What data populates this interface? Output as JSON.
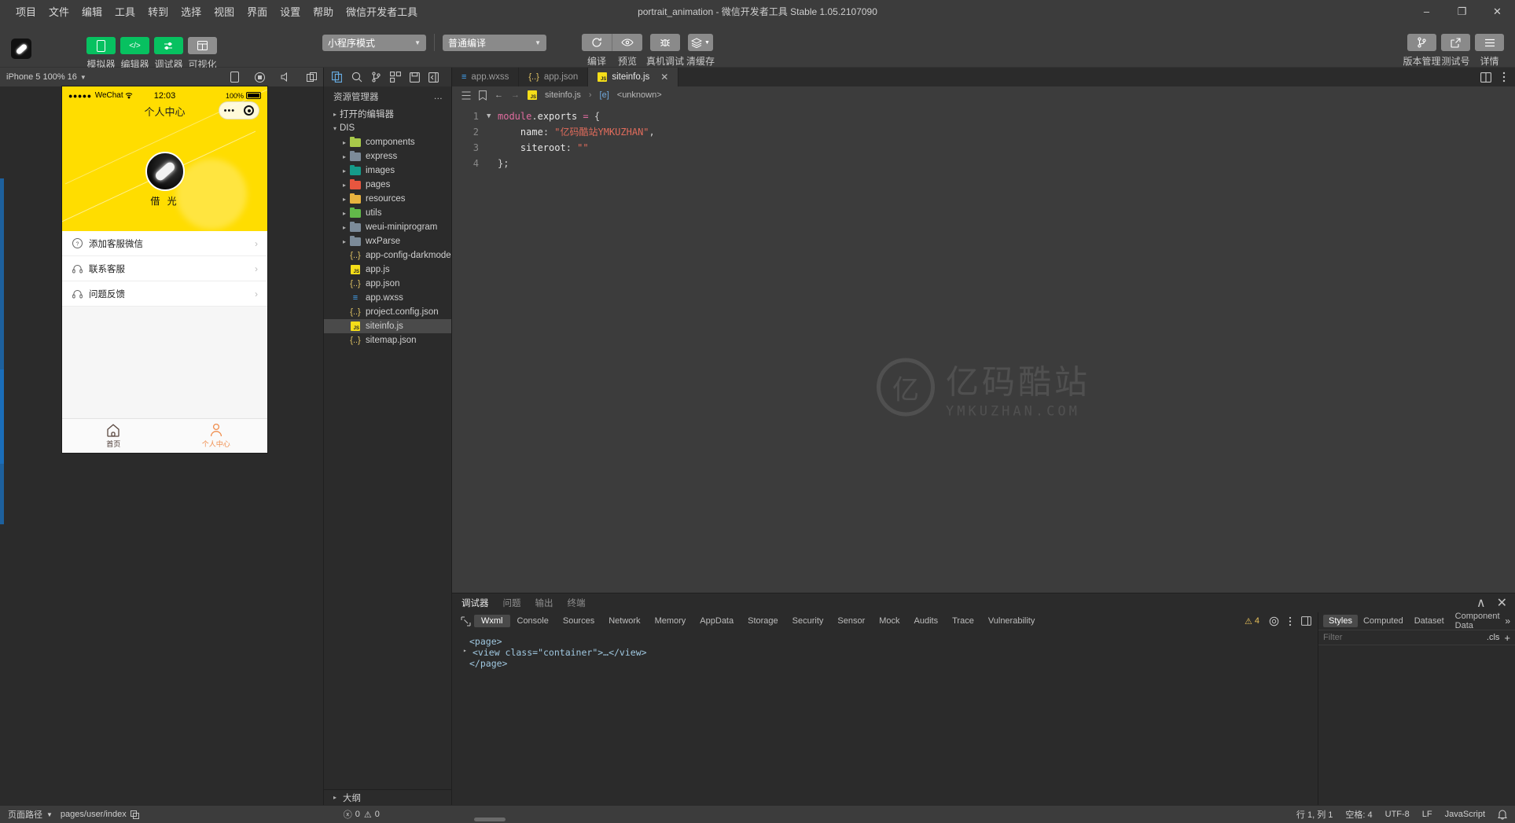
{
  "window": {
    "title": "portrait_animation - 微信开发者工具 Stable 1.05.2107090",
    "minimize": "–",
    "maximize": "❐",
    "close": "✕"
  },
  "menu": [
    "项目",
    "文件",
    "编辑",
    "工具",
    "转到",
    "选择",
    "视图",
    "界面",
    "设置",
    "帮助",
    "微信开发者工具"
  ],
  "toolbar": {
    "view_buttons": [
      {
        "label": "模拟器",
        "icon": "phone-icon",
        "state": "green"
      },
      {
        "label": "编辑器",
        "icon": "code-icon",
        "state": "green"
      },
      {
        "label": "调试器",
        "icon": "sliders-icon",
        "state": "green"
      },
      {
        "label": "可视化",
        "icon": "layout-icon",
        "state": "grey"
      }
    ],
    "mode_select": "小程序模式",
    "compile_select": "普通编译",
    "actions": [
      {
        "label": "编译",
        "icon": "refresh-icon"
      },
      {
        "label": "预览",
        "icon": "eye-icon"
      },
      {
        "label": "真机调试",
        "icon": "bug-icon"
      },
      {
        "label": "清缓存",
        "icon": "layers-icon"
      }
    ],
    "right_actions": [
      {
        "label": "版本管理",
        "icon": "branch-icon"
      },
      {
        "label": "测试号",
        "icon": "external-link-icon"
      },
      {
        "label": "详情",
        "icon": "hamburger-icon"
      }
    ]
  },
  "simulator": {
    "device_label": "iPhone 5 100% 16",
    "phone": {
      "carrier": "WeChat",
      "signal_dots": "●●●●●",
      "time": "12:03",
      "battery": "100%",
      "nav_title": "个人中心",
      "user_name": "借 光",
      "rows": [
        {
          "label": "添加客服微信",
          "icon": "question-circle-icon"
        },
        {
          "label": "联系客服",
          "icon": "headset-icon"
        },
        {
          "label": "问题反馈",
          "icon": "headset-icon"
        }
      ],
      "tabs": [
        {
          "label": "首页",
          "icon": "home-icon",
          "active": false
        },
        {
          "label": "个人中心",
          "icon": "user-icon",
          "active": true
        }
      ]
    }
  },
  "explorer": {
    "title": "资源管理器",
    "more": "…",
    "open_editors": "打开的编辑器",
    "root": "DIS",
    "outline": "大纲",
    "items": [
      {
        "name": "components",
        "type": "folder",
        "color": "#a8c94a",
        "badge": ""
      },
      {
        "name": "express",
        "type": "folder",
        "color": "#7c8b99",
        "badge": ""
      },
      {
        "name": "images",
        "type": "folder",
        "color": "#159b8a",
        "badge": ""
      },
      {
        "name": "pages",
        "type": "folder",
        "color": "#e8563f",
        "badge": ""
      },
      {
        "name": "resources",
        "type": "folder",
        "color": "#e8b33f",
        "badge": ""
      },
      {
        "name": "utils",
        "type": "folder",
        "color": "#62b94a",
        "badge": ""
      },
      {
        "name": "weui-miniprogram",
        "type": "folder",
        "color": "#7c8b99",
        "badge": ""
      },
      {
        "name": "wxParse",
        "type": "folder",
        "color": "#7c8b99",
        "badge": ""
      },
      {
        "name": "app-config-darkmode.j...",
        "type": "json",
        "color": "",
        "badge": ""
      },
      {
        "name": "app.js",
        "type": "js",
        "color": "",
        "badge": ""
      },
      {
        "name": "app.json",
        "type": "json",
        "color": "",
        "badge": ""
      },
      {
        "name": "app.wxss",
        "type": "wxss",
        "color": "",
        "badge": ""
      },
      {
        "name": "project.config.json",
        "type": "json",
        "color": "",
        "badge": ""
      },
      {
        "name": "siteinfo.js",
        "type": "js",
        "color": "",
        "badge": "",
        "selected": true
      },
      {
        "name": "sitemap.json",
        "type": "json",
        "color": "",
        "badge": ""
      }
    ]
  },
  "editor": {
    "tabs": [
      {
        "label": "app.wxss",
        "type": "wxss",
        "active": false,
        "closable": false
      },
      {
        "label": "app.json",
        "type": "json",
        "active": false,
        "closable": false
      },
      {
        "label": "siteinfo.js",
        "type": "js",
        "active": true,
        "closable": true
      }
    ],
    "breadcrumb": {
      "file": "siteinfo.js",
      "symbol": "<unknown>",
      "symbol_icon": "[e]",
      "sep": "›"
    },
    "lines": [
      {
        "n": "1",
        "fold": true,
        "text": "module.exports = {"
      },
      {
        "n": "2",
        "fold": false,
        "text": "    name: \"亿码酷站YMKUZHAN\","
      },
      {
        "n": "3",
        "fold": false,
        "text": "    siteroot: \"\""
      },
      {
        "n": "4",
        "fold": false,
        "text": "};"
      }
    ],
    "watermark": {
      "glyph": "亿",
      "line1": "亿码酷站",
      "line2": "YMKUZHAN.COM"
    }
  },
  "devtools": {
    "panel_tabs": [
      {
        "label": "调试器",
        "active": true
      },
      {
        "label": "问题",
        "active": false
      },
      {
        "label": "输出",
        "active": false
      },
      {
        "label": "终端",
        "active": false
      }
    ],
    "tabs": [
      "Wxml",
      "Console",
      "Sources",
      "Network",
      "Memory",
      "AppData",
      "Storage",
      "Security",
      "Sensor",
      "Mock",
      "Audits",
      "Trace",
      "Vulnerability"
    ],
    "active_tab": "Wxml",
    "warning_count": "4",
    "wxml": [
      {
        "indent": 0,
        "arrow": false,
        "html": "&lt;page&gt;"
      },
      {
        "indent": 1,
        "arrow": true,
        "html": "&lt;view class=\"container\"&gt;…&lt;/view&gt;"
      },
      {
        "indent": 0,
        "arrow": false,
        "html": "&lt;/page&gt;"
      }
    ],
    "style_tabs": [
      "Styles",
      "Computed",
      "Dataset",
      "Component Data"
    ],
    "active_style_tab": "Styles",
    "filter_placeholder": "Filter",
    "cls_label": ".cls",
    "plus_label": "+",
    "overflow": "»"
  },
  "statusbar": {
    "page_path_label": "页面路径",
    "page_path_value": "pages/user/index",
    "errors": "0",
    "warnings": "0",
    "cursor": "行 1, 列 1",
    "spaces": "空格: 4",
    "encoding": "UTF-8",
    "eol": "LF",
    "language": "JavaScript"
  }
}
